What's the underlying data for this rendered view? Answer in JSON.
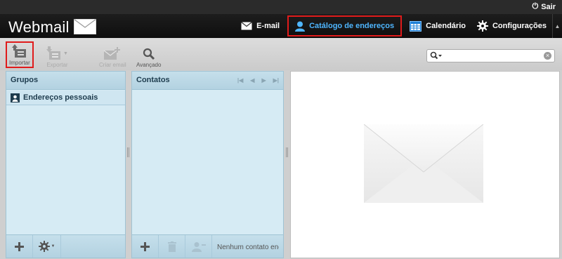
{
  "topbar": {
    "logout_label": "Sair",
    "logout_icon": "power-icon"
  },
  "header": {
    "brand": "Webmail",
    "nav": [
      {
        "label": "E-mail",
        "icon": "envelope-icon"
      },
      {
        "label": "Catálogo de endereços",
        "icon": "user-icon",
        "active": true
      },
      {
        "label": "Calendário",
        "icon": "calendar-icon"
      },
      {
        "label": "Configurações",
        "icon": "gear-icon"
      }
    ]
  },
  "toolbar": {
    "import_label": "Importar",
    "export_label": "Exportar",
    "create_email_label": "Criar email",
    "advanced_label": "Avançado"
  },
  "search": {
    "value": "",
    "placeholder": ""
  },
  "groups_panel": {
    "title": "Grupos",
    "items": [
      {
        "label": "Endereços pessoais"
      }
    ]
  },
  "contacts_panel": {
    "title": "Contatos",
    "empty_text": "Nenhum contato encontrado"
  },
  "colors": {
    "accent": "#4fb6ff",
    "highlight": "#e01b1b",
    "panel": "#d6ebf4"
  }
}
